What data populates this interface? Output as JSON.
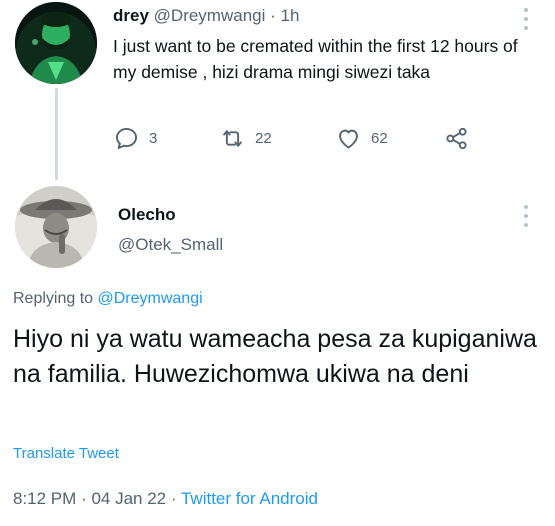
{
  "parent_tweet": {
    "display_name": "drey",
    "handle": "@Dreymwangi",
    "separator": "·",
    "time": "1h",
    "text": "I just want to be cremated within the first 12 hours of my demise , hizi drama mingi siwezi taka",
    "replies": "3",
    "retweets": "22",
    "likes": "62"
  },
  "reply_tweet": {
    "display_name": "Olecho",
    "handle": "@Otek_Small",
    "replying_prefix": "Replying to",
    "replying_to": "@Dreymwangi",
    "text": "Hiyo ni ya watu wameacha pesa za kupiganiwa na familia. Huwezichomwa ukiwa na deni",
    "translate_label": "Translate Tweet",
    "time": "8:12 PM",
    "separator": "·",
    "date": "04 Jan 22",
    "source": "Twitter for Android"
  },
  "icons": [
    "reply-icon",
    "retweet-icon",
    "like-icon",
    "share-icon",
    "more-icon"
  ],
  "colors": {
    "accent": "#1d9bf0",
    "secondary_text": "#536471",
    "thread_line": "#cfd9de"
  }
}
